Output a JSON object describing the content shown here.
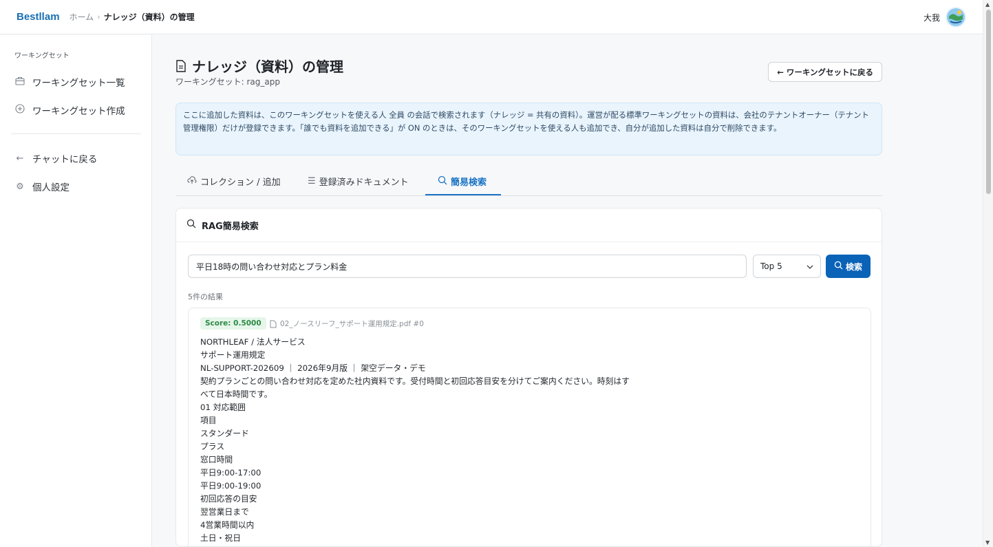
{
  "header": {
    "brand": "Bestllam",
    "breadcrumb_home": "ホーム",
    "breadcrumb_sep": "›",
    "breadcrumb_current": "ナレッジ（資料）の管理",
    "user_name": "大我"
  },
  "sidebar": {
    "section_label": "ワーキングセット",
    "items": [
      {
        "label": "ワーキングセット一覧",
        "icon": "briefcase-icon"
      },
      {
        "label": "ワーキングセット作成",
        "icon": "plus-circle-icon"
      },
      {
        "label": "チャットに戻る",
        "icon": "arrow-left-icon"
      },
      {
        "label": "個人設定",
        "icon": "gear-icon"
      }
    ]
  },
  "page": {
    "title": "ナレッジ（資料）の管理",
    "subtitle": "ワーキングセット: rag_app",
    "back_button": "← ワーキングセットに戻る",
    "notice": "ここに追加した資料は、このワーキングセットを使える人 全員 の会話で検索されます（ナレッジ = 共有の資料）。運営が配る標準ワーキングセットの資料は、会社のテナントオーナー（テナント管理権限）だけが登録できます。「誰でも資料を追加できる」が ON のときは、そのワーキングセットを使える人も追加でき、自分が追加した資料は自分で削除できます。"
  },
  "tabs": [
    {
      "label": "コレクション / 追加",
      "icon": "upload-icon"
    },
    {
      "label": "登録済みドキュメント",
      "icon": "list-icon"
    },
    {
      "label": "簡易検索",
      "icon": "search-icon"
    }
  ],
  "search": {
    "card_title": "RAG簡易検索",
    "query": "平日18時の問い合わせ対応とプラン料金",
    "topk": "Top 5",
    "button": "検索",
    "result_count": "5件の結果"
  },
  "results": [
    {
      "score": "Score: 0.5000",
      "file": "02_ノースリーフ_サポート運用規定.pdf #0",
      "lines": [
        "NORTHLEAF / 法人サービス",
        "サポート運用規定",
        "NL-SUPPORT-202609 ｜ 2026年9月版 ｜ 架空データ・デモ",
        "契約プランごとの問い合わせ対応を定めた社内資料です。受付時間と初回応答目安を分けてご案内ください。時刻はす",
        "べて日本時間です。",
        "01 対応範囲",
        "項目",
        "スタンダード",
        "プラス",
        "窓口時間",
        "平日9:00-17:00",
        "平日9:00-19:00",
        "初回応答の目安",
        "翌営業日まで",
        "4営業時間以内",
        "土日・祝日"
      ]
    }
  ]
}
